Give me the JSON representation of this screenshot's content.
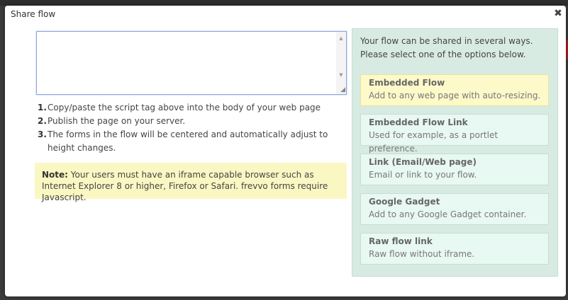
{
  "dialog": {
    "title": "Share flow",
    "close_symbol": "✖"
  },
  "script_box": {
    "value": ""
  },
  "steps": [
    {
      "num": "1.",
      "text": "Copy/paste the script tag above into the body of your web page"
    },
    {
      "num": "2.",
      "text": "Publish the page on your server."
    },
    {
      "num": "3.",
      "text": "The forms in the flow will be centered and automatically adjust to height changes."
    }
  ],
  "note": {
    "label": "Note:",
    "text": " Your users must have an iframe capable browser such as Internet Explorer 8 or higher, Firefox or Safari. frevvo forms require Javascript."
  },
  "options_panel": {
    "intro": "Your flow can be shared in several ways. Please select one of the options below.",
    "options": [
      {
        "title": "Embedded Flow",
        "desc": "Add to any web page with auto-resizing.",
        "selected": true
      },
      {
        "title": "Embedded Flow Link",
        "desc": "Used for example, as a portlet preference.",
        "selected": false
      },
      {
        "title": "Link (Email/Web page)",
        "desc": "Email or link to your flow.",
        "selected": false
      },
      {
        "title": "Google Gadget",
        "desc": "Add to any Google Gadget container.",
        "selected": false
      },
      {
        "title": "Raw flow link",
        "desc": "Raw flow without iframe.",
        "selected": false
      }
    ]
  },
  "icons": {
    "close": "close-icon",
    "scroll_up": "scroll-up-arrow-icon",
    "scroll_down": "scroll-down-arrow-icon",
    "resize": "resize-grip-icon"
  },
  "colors": {
    "selected_option": "#fdf9c8",
    "option": "#e8f8f3",
    "panel": "#d8ebe2",
    "note": "#fbf7c3",
    "focus_border": "#8fa8d8"
  }
}
